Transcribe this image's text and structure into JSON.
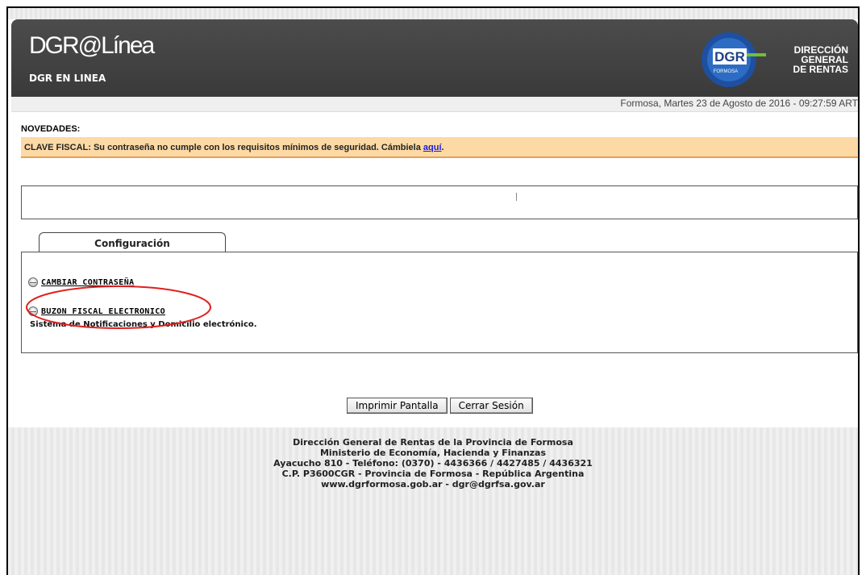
{
  "header": {
    "title": "DGR@Línea",
    "subtitle": "DGR EN LINEA",
    "logo_text": "DGR",
    "logo_subtext": "FORMOSA",
    "org_line1": "DIRECCIÓN",
    "org_line2": "GENERAL",
    "org_line3": "DE RENTAS"
  },
  "date_line": "Formosa, Martes 23 de Agosto de 2016 - 09:27:59 ART",
  "news": {
    "title": "NOVEDADES:",
    "alert_text": "CLAVE FISCAL: Su contraseña no cumple con los requisitos mínimos de seguridad. Cámbiela ",
    "alert_link": "aquí",
    "alert_end": "."
  },
  "tabs": [
    {
      "label": "Configuración"
    }
  ],
  "options": [
    {
      "label": "CAMBIAR CONTRASEÑA"
    },
    {
      "label": "BUZON FISCAL ELECTRONICO",
      "description": "Sistema de Notificaciones y Domicilio electrónico."
    }
  ],
  "buttons": {
    "print": "Imprimir Pantalla",
    "logout": "Cerrar Sesión"
  },
  "footer": {
    "line1": "Dirección General de Rentas de la Provincia de Formosa",
    "line2": "Ministerio de Economía, Hacienda y Finanzas",
    "line3": "Ayacucho 810 - Teléfono: (0370) - 4436366 / 4427485 / 4436321",
    "line4": "C.P. P3600CGR - Provincia de Formosa - República Argentina",
    "line5": "www.dgrformosa.gob.ar - dgr@dgrfsa.gov.ar"
  },
  "colors": {
    "header_bg": "#3f3f3f",
    "alert_bg": "#fdd9a5",
    "alert_border": "#e8a052",
    "link": "#1a1ae0",
    "highlight_ellipse": "#e02020",
    "logo_blue": "#1f4fa0",
    "logo_green": "#6fbf3a"
  }
}
